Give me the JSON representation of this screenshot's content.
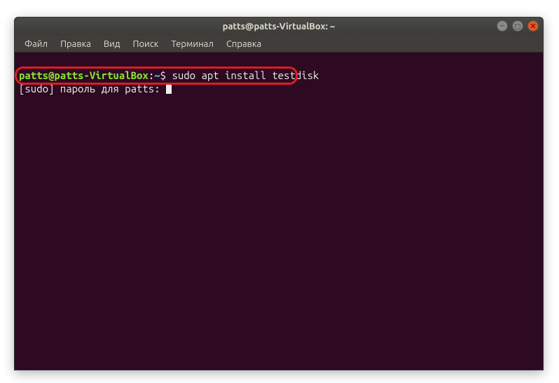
{
  "window": {
    "title": "patts@patts-VirtualBox: ~"
  },
  "menu": {
    "file": "Файл",
    "edit": "Правка",
    "view": "Вид",
    "search": "Поиск",
    "terminal": "Терминал",
    "help": "Справка"
  },
  "prompt": {
    "user": "patts",
    "at": "@",
    "host": "patts-VirtualBox",
    "colon": ":",
    "path": "~",
    "dollar": "$"
  },
  "terminal": {
    "command": "sudo apt install testdisk",
    "password_prompt": "[sudo] пароль для patts: "
  },
  "window_controls": {
    "minimize": "–",
    "maximize": "◻",
    "close": "✕"
  }
}
